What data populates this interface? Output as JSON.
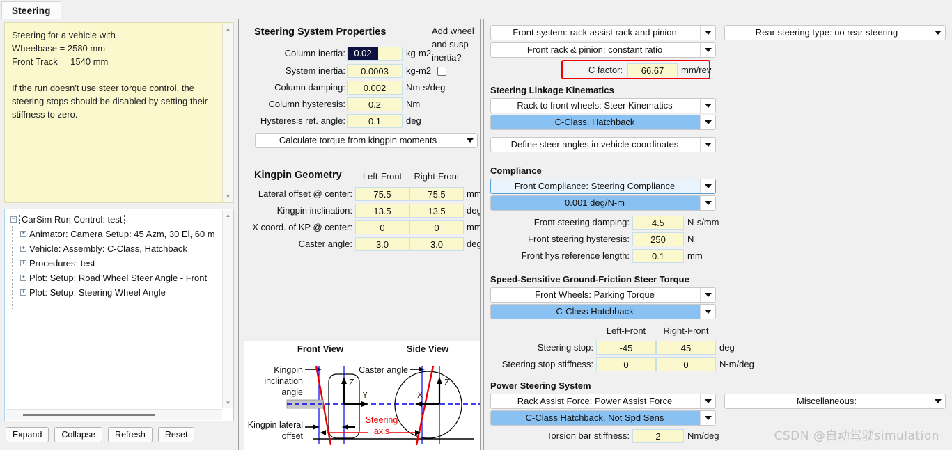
{
  "tab": {
    "label": "Steering"
  },
  "notes": {
    "text": "Steering for a vehicle with\nWheelbase = 2580 mm\nFront Track =  1540 mm\n\nIf the run doesn't use steer torque control, the\nsteering stops should be disabled by setting their\nstiffness to zero."
  },
  "tree": {
    "root": "CarSim Run Control: test",
    "children": [
      "Animator: Camera Setup: 45 Azm, 30 El, 60 m",
      "Vehicle: Assembly: C-Class, Hatchback",
      "Procedures: test",
      "Plot: Setup: Road Wheel Steer Angle - Front",
      "Plot: Setup: Steering Wheel Angle"
    ]
  },
  "tree_buttons": [
    "Expand",
    "Collapse",
    "Refresh",
    "Reset"
  ],
  "steering_system": {
    "title": "Steering System Properties",
    "add_inertia_question": "Add wheel and susp inertia?",
    "rows": [
      {
        "label": "Column inertia:",
        "value": "0.02",
        "unit": "kg-m2",
        "selected": true
      },
      {
        "label": "System inertia:",
        "value": "0.0003",
        "unit": "kg-m2",
        "selected": false
      },
      {
        "label": "Column damping:",
        "value": "0.002",
        "unit": "Nm-s/deg",
        "selected": false
      },
      {
        "label": "Column hysteresis:",
        "value": "0.2",
        "unit": "Nm",
        "selected": false
      },
      {
        "label": "Hysteresis ref. angle:",
        "value": "0.1",
        "unit": "deg",
        "selected": false
      }
    ],
    "torque_mode": "Calculate torque from kingpin moments"
  },
  "kingpin": {
    "title": "Kingpin Geometry",
    "col_left": "Left-Front",
    "col_right": "Right-Front",
    "rows": [
      {
        "label": "Lateral offset @ center:",
        "left": "75.5",
        "right": "75.5",
        "unit": "mm"
      },
      {
        "label": "Kingpin inclination:",
        "left": "13.5",
        "right": "13.5",
        "unit": "deg"
      },
      {
        "label": "X coord. of KP @ center:",
        "left": "0",
        "right": "0",
        "unit": "mm"
      },
      {
        "label": "Caster angle:",
        "left": "3.0",
        "right": "3.0",
        "unit": "deg"
      }
    ]
  },
  "diagram": {
    "front_view": "Front View",
    "side_view": "Side View",
    "kingpin_inclination_angle": "Kingpin\ninclination\nangle",
    "kingpin_lateral_offset": "Kingpin lateral\noffset",
    "caster_angle": "Caster angle",
    "steering_axis": "Steering\naxis",
    "axis_z": "Z",
    "axis_y": "Y",
    "axis_x": "X",
    "axis_z2": "Z"
  },
  "right": {
    "front_system": "Front system: rack assist rack and pinion",
    "front_rack_pinion": "Front rack & pinion: constant ratio",
    "c_factor": {
      "label": "C factor:",
      "value": "66.67",
      "unit": "mm/rev"
    },
    "linkage_title": "Steering Linkage Kinematics",
    "rack_to_front_wheels": "Rack to front wheels: Steer Kinematics",
    "rack_dataset": "C-Class, Hatchback",
    "define_steer_angles": "Define steer angles in vehicle coordinates",
    "compliance_title": "Compliance",
    "front_compliance": "Front Compliance: Steering Compliance",
    "front_compliance_value": "0.001 deg/N-m",
    "compliance_rows": [
      {
        "label": "Front steering damping:",
        "value": "4.5",
        "unit": "N-s/mm"
      },
      {
        "label": "Front steering hysteresis:",
        "value": "250",
        "unit": "N"
      },
      {
        "label": "Front hys reference length:",
        "value": "0.1",
        "unit": "mm"
      }
    ],
    "speed_sensitive_title": "Speed-Sensitive Ground-Friction Steer Torque",
    "parking_torque": "Front Wheels: Parking Torque",
    "parking_torque_dataset": "C-Class Hatchback",
    "col_left": "Left-Front",
    "col_right": "Right-Front",
    "stop_rows": [
      {
        "label": "Steering stop:",
        "left": "-45",
        "right": "45",
        "unit": "deg"
      },
      {
        "label": "Steering stop stiffness:",
        "left": "0",
        "right": "0",
        "unit": "N-m/deg"
      }
    ],
    "power_title": "Power Steering System",
    "rack_assist_force": "Rack Assist Force: Power Assist Force",
    "rack_assist_dataset": "C-Class Hatchback, Not Spd Sens",
    "torsion_bar": {
      "label": "Torsion bar stiffness:",
      "value": "2",
      "unit": "Nm/deg"
    },
    "rear_steering_type": "Rear steering type: no rear steering",
    "miscellaneous": "Miscellaneous:"
  },
  "watermark": "CSDN @自动驾驶simulation"
}
